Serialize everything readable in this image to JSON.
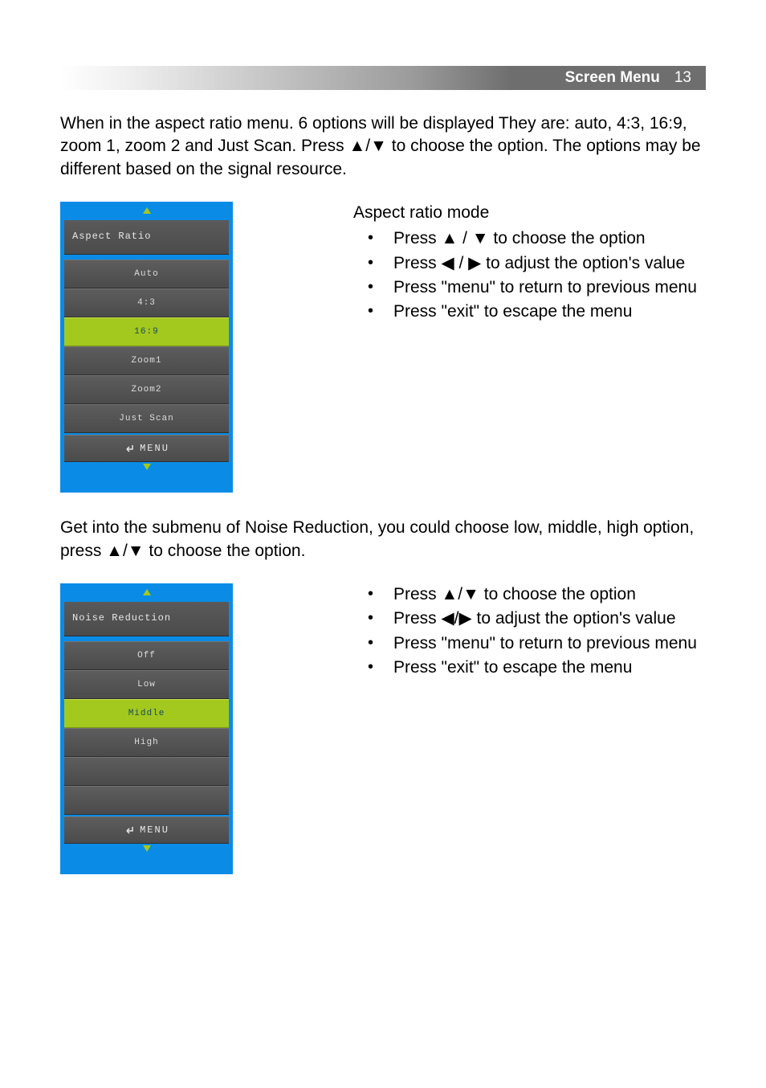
{
  "header": {
    "title": "Screen Menu",
    "page": "13"
  },
  "intro1": "When in the aspect ratio menu. 6 options will be displayed They are: auto, 4:3, 16:9, zoom 1, zoom 2 and Just Scan. Press  ▲/▼  to choose the option. The options may be different based on the signal resource.",
  "osd1": {
    "title": "Aspect Ratio",
    "menu_label": "MENU",
    "items": [
      "Auto",
      "4:3",
      "16:9",
      "Zoom1",
      "Zoom2",
      "Just Scan"
    ],
    "selected_index": 2
  },
  "section1": {
    "heading": "Aspect ratio mode",
    "bullets": [
      "Press ▲ / ▼ to choose the option",
      "Press ◀ / ▶ to adjust the option's value",
      "Press \"menu\" to return to previous menu",
      "Press \"exit\" to escape the menu"
    ]
  },
  "intro2": "Get into the submenu of Noise Reduction, you could choose low, middle, high option, press  ▲/▼  to choose the option.",
  "osd2": {
    "title": "Noise Reduction",
    "menu_label": "MENU",
    "items": [
      "Off",
      "Low",
      "Middle",
      "High",
      "",
      ""
    ],
    "selected_index": 2
  },
  "section2": {
    "bullets": [
      "Press ▲/▼  to choose the option",
      "Press  ◀/▶ to adjust the option's value",
      "Press \"menu\" to return to previous menu",
      "Press \"exit\" to escape the menu"
    ]
  }
}
